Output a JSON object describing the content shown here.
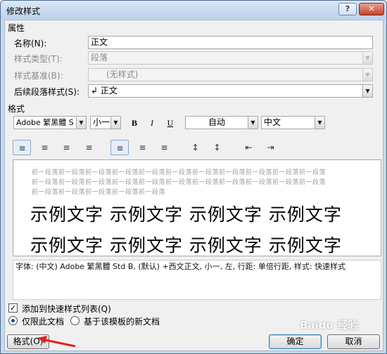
{
  "window": {
    "title": "修改样式"
  },
  "titlebar": {
    "help": "?",
    "close": "✕"
  },
  "properties": {
    "section": "属性",
    "name_label": "名称(N):",
    "name_value": "正文",
    "type_label": "样式类型(T):",
    "type_value": "段落",
    "based_label": "样式基准(B):",
    "based_value": "(无样式)",
    "next_label": "后续段落样式(S):",
    "next_value": "↲ 正文"
  },
  "format": {
    "section": "格式",
    "font": "Adobe 繁黑體 S",
    "size": "小一",
    "bold": "B",
    "italic": "I",
    "underline": "U",
    "color": "自动",
    "lang": "中文"
  },
  "paragraph_buttons": [
    "≡",
    "≡",
    "≡",
    "≡",
    "≡",
    "≡",
    "≡",
    "↕",
    "↕",
    "⇤",
    "⇥"
  ],
  "preview": {
    "prev_lines": [
      "前一段落前一段落前一段落前一段落前一段落前一段落前一段落前一段落前一段落前一段落前一段落",
      "前一段落前一段落前一段落前一段落前一段落前一段落前一段落前一段落前一段落前一段落前一段落",
      "前一段落前一段落前一段落前一段落前一段落"
    ],
    "sample_lines": [
      "示例文字 示例文字 示例文字 示例文字",
      "示例文字 示例文字 示例文字 示例文字"
    ]
  },
  "description": "字体: (中文) Adobe 繁黑體 Std B, (默认) +西文正文, 小一, 左, 行距: 单倍行距, 样式: 快速样式",
  "options": {
    "add_quick": "添加到快速样式列表(Q)",
    "only_doc": "仅限此文档",
    "template": "基于该模板的新文档"
  },
  "buttons": {
    "format": "格式(O)",
    "ok": "确定",
    "cancel": "取消"
  },
  "watermark": "Baidu 经验"
}
